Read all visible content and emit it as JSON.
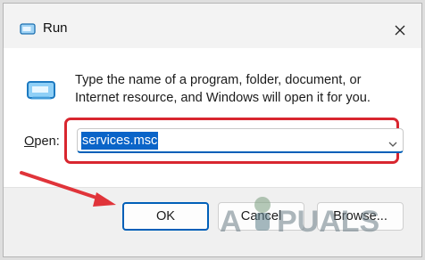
{
  "window": {
    "title": "Run",
    "description": "Type the name of a program, folder, document, or Internet resource, and Windows will open it for you.",
    "open_label_prefix": "",
    "open_label_underlined": "O",
    "open_label_rest": "pen:",
    "open_value": "services.msc",
    "buttons": {
      "ok": "OK",
      "cancel": "Cancel",
      "browse": "Browse..."
    }
  },
  "icons": {
    "app": "run-app-icon",
    "run": "run-dialog-icon",
    "close": "close-icon",
    "dropdown": "chevron-down-icon"
  },
  "colors": {
    "highlight": "#d8262f",
    "accent": "#005fb8",
    "selection": "#0a64c8"
  },
  "watermark": {
    "text": "APPUALS"
  }
}
